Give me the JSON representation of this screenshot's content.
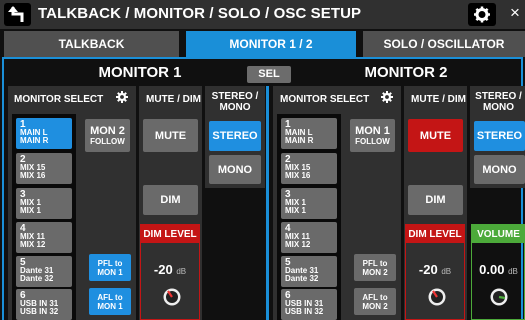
{
  "header": {
    "title": "TALKBACK / MONITOR / SOLO / OSC SETUP",
    "close_label": "×"
  },
  "tabs": [
    {
      "label": "TALKBACK",
      "active": false
    },
    {
      "label": "MONITOR 1 / 2",
      "active": true
    },
    {
      "label": "SOLO / OSCILLATOR",
      "active": false
    }
  ],
  "sel_label": "SEL",
  "monitor1": {
    "title": "MONITOR 1",
    "select_header": "MONITOR SELECT",
    "mute_dim_header": "MUTE / DIM",
    "stereo_mono_header_1": "STEREO /",
    "stereo_mono_header_2": "MONO",
    "sources": [
      {
        "num": "1",
        "l1": "MAIN L",
        "l2": "MAIN R",
        "selected": true
      },
      {
        "num": "2",
        "l1": "MIX 15",
        "l2": "MIX 16",
        "selected": false
      },
      {
        "num": "3",
        "l1": "MIX 1",
        "l2": "MIX 1",
        "selected": false
      },
      {
        "num": "4",
        "l1": "MIX 11",
        "l2": "MIX 12",
        "selected": false
      },
      {
        "num": "5",
        "l1": "Dante 31",
        "l2": "Dante 32",
        "selected": false
      },
      {
        "num": "6",
        "l1": "USB IN 31",
        "l2": "USB IN 32",
        "selected": false
      }
    ],
    "follow_l1": "MON 2",
    "follow_l2": "FOLLOW",
    "pfl_l1": "PFL to",
    "pfl_l2": "MON 1",
    "afl_l1": "AFL to",
    "afl_l2": "MON 1",
    "mute_label": "MUTE",
    "mute_on": false,
    "dim_label": "DIM",
    "dim_level_label": "DIM LEVEL",
    "dim_level_value": "-20",
    "dim_level_unit": "dB",
    "stereo_label": "STEREO",
    "mono_label": "MONO"
  },
  "monitor2": {
    "title": "MONITOR 2",
    "select_header": "MONITOR SELECT",
    "mute_dim_header": "MUTE / DIM",
    "stereo_mono_header_1": "STEREO /",
    "stereo_mono_header_2": "MONO",
    "sources": [
      {
        "num": "1",
        "l1": "MAIN L",
        "l2": "MAIN R"
      },
      {
        "num": "2",
        "l1": "MIX 15",
        "l2": "MIX 16"
      },
      {
        "num": "3",
        "l1": "MIX 1",
        "l2": "MIX 1"
      },
      {
        "num": "4",
        "l1": "MIX 11",
        "l2": "MIX 12"
      },
      {
        "num": "5",
        "l1": "Dante 31",
        "l2": "Dante 32"
      },
      {
        "num": "6",
        "l1": "USB IN 31",
        "l2": "USB IN 32"
      }
    ],
    "follow_l1": "MON 1",
    "follow_l2": "FOLLOW",
    "pfl_l1": "PFL to",
    "pfl_l2": "MON 2",
    "afl_l1": "AFL to",
    "afl_l2": "MON 2",
    "mute_label": "MUTE",
    "mute_on": true,
    "dim_label": "DIM",
    "dim_level_label": "DIM LEVEL",
    "dim_level_value": "-20",
    "dim_level_unit": "dB",
    "stereo_label": "STEREO",
    "mono_label": "MONO",
    "volume_label": "VOLUME",
    "volume_value": "0.00",
    "volume_unit": "dB"
  },
  "colors": {
    "accent": "#1a8fd8",
    "selected": "#1f8fe0",
    "mute_on": "#c41515",
    "volume": "#4caa3a"
  }
}
